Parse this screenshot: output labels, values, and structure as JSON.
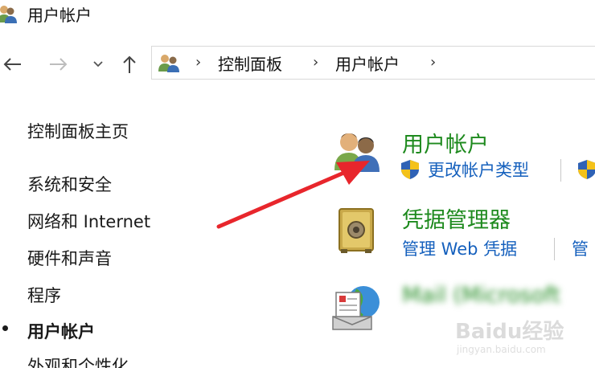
{
  "window": {
    "title": "用户帐户",
    "icon": "users-icon"
  },
  "navigation": {
    "back_icon": "arrow-left-icon",
    "forward_icon": "arrow-right-icon",
    "recent_icon": "chevron-down-icon",
    "up_icon": "arrow-up-icon"
  },
  "address_bar": {
    "icon": "users-icon",
    "breadcrumbs": [
      "控制面板",
      "用户帐户"
    ],
    "separator": "›"
  },
  "sidebar": {
    "items": [
      {
        "label": "控制面板主页",
        "active": false
      },
      {
        "label": "系统和安全",
        "active": false
      },
      {
        "label": "网络和 Internet",
        "active": false
      },
      {
        "label": "硬件和声音",
        "active": false
      },
      {
        "label": "程序",
        "active": false
      },
      {
        "label": "用户帐户",
        "active": true
      },
      {
        "label": "外观和个性化",
        "active": false
      }
    ]
  },
  "categories": [
    {
      "title": "用户帐户",
      "icon": "user-accounts-icon",
      "links": [
        "更改帐户类型"
      ],
      "link_icon": "uac-shield-icon"
    },
    {
      "title": "凭据管理器",
      "icon": "credential-vault-icon",
      "links": [
        "管理 Web 凭据",
        "管"
      ]
    },
    {
      "title": "Mail (Microsoft",
      "icon": "mail-icon",
      "links": []
    }
  ],
  "watermark": {
    "logo": "Baidu经验",
    "sub": "jingyan.baidu.com"
  },
  "colors": {
    "category_title": "#1e8a1e",
    "link": "#1560bd",
    "annotation_arrow": "#e8262c"
  }
}
